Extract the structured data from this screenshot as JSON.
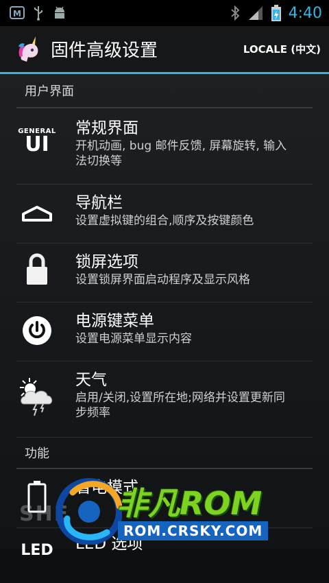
{
  "status_bar": {
    "time": "4:40",
    "icons": [
      "mail-icon",
      "usb-icon",
      "android-debug-icon",
      "bluetooth-icon",
      "signal-icon",
      "battery-charging-icon"
    ]
  },
  "action_bar": {
    "title": "固件高级设置",
    "locale_label": "LOCALE (中文)",
    "app_icon": "unicorn-icon"
  },
  "categories": {
    "ui": "用户界面",
    "features": "功能"
  },
  "items": [
    {
      "title": "常规界面",
      "summary": "开机动画, bug 邮件反馈, 屏幕旋转, 输入法切换等",
      "icon": "general-ui-icon",
      "icon_top": "GENERAL",
      "icon_main": "UI"
    },
    {
      "title": "导航栏",
      "summary": "设置虚拟键的组合,顺序及按键颜色",
      "icon": "navigation-bar-icon"
    },
    {
      "title": "锁屏选项",
      "summary": "设置锁屏界面启动程序及显示风格",
      "icon": "lock-icon"
    },
    {
      "title": "电源键菜单",
      "summary": "设置电源菜单显示内容",
      "icon": "power-icon"
    },
    {
      "title": "天气",
      "summary": "启用/关闭,设置所在地;网络并设置更新同步频率",
      "icon": "weather-icon"
    },
    {
      "title": "省电模式",
      "summary": "",
      "icon": "battery-icon"
    },
    {
      "title": "LED 选项",
      "summary": "",
      "icon": "led-icon",
      "icon_main": "LED"
    }
  ],
  "watermark": {
    "brand": "非凡ROM",
    "url": "ROM.CRSKY.COM",
    "faded": "SHE"
  },
  "colors": {
    "accent": "#33b5e5",
    "watermark_green": "#7ed321",
    "watermark_blue": "#1565c0"
  }
}
